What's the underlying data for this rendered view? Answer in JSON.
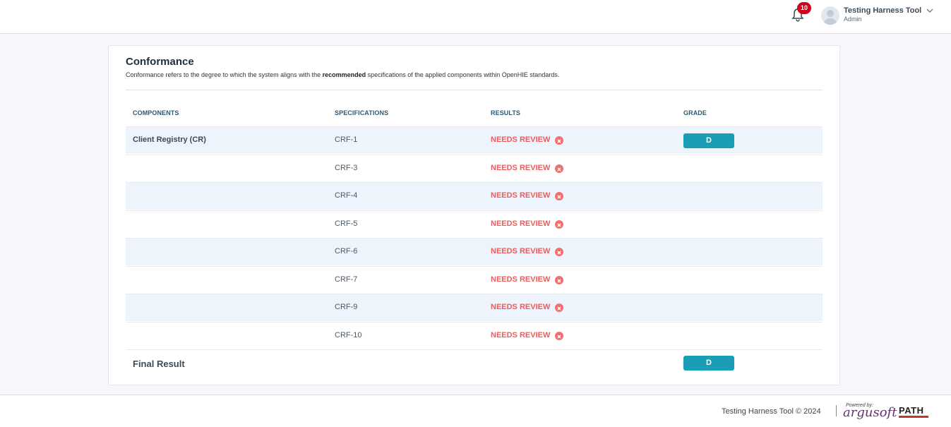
{
  "header": {
    "notification_count": "10",
    "user_name": "Testing Harness Tool",
    "user_role": "Admin"
  },
  "card": {
    "title": "Conformance",
    "description_before": "Conformance refers to the degree to which the system aligns with the ",
    "description_bold": "recommended",
    "description_after": " specifications of the applied components within OpenHIE standards."
  },
  "table": {
    "headers": {
      "components": "COMPONENTS",
      "specifications": "SPECIFICATIONS",
      "results": "RESULTS",
      "grade": "GRADE"
    },
    "component": "Client Registry (CR)",
    "component_grade": "D",
    "rows": [
      {
        "spec": "CRF-1",
        "result": "NEEDS REVIEW"
      },
      {
        "spec": "CRF-3",
        "result": "NEEDS REVIEW"
      },
      {
        "spec": "CRF-4",
        "result": "NEEDS REVIEW"
      },
      {
        "spec": "CRF-5",
        "result": "NEEDS REVIEW"
      },
      {
        "spec": "CRF-6",
        "result": "NEEDS REVIEW"
      },
      {
        "spec": "CRF-7",
        "result": "NEEDS REVIEW"
      },
      {
        "spec": "CRF-9",
        "result": "NEEDS REVIEW"
      },
      {
        "spec": "CRF-10",
        "result": "NEEDS REVIEW"
      }
    ],
    "final_label": "Final Result",
    "final_grade": "D"
  },
  "footer": {
    "copyright": "Testing Harness Tool © 2024",
    "separator": "|",
    "powered_by": "Powered by:",
    "argusoft_logo": "argusoft",
    "path_logo": "PATH"
  },
  "colors": {
    "accent": "#1a9db5",
    "needs_review": "#f05a5a",
    "badge": "#d0021b"
  },
  "icons": [
    "bell-icon",
    "avatar-icon",
    "chevron-down-icon",
    "close-circle-icon"
  ]
}
